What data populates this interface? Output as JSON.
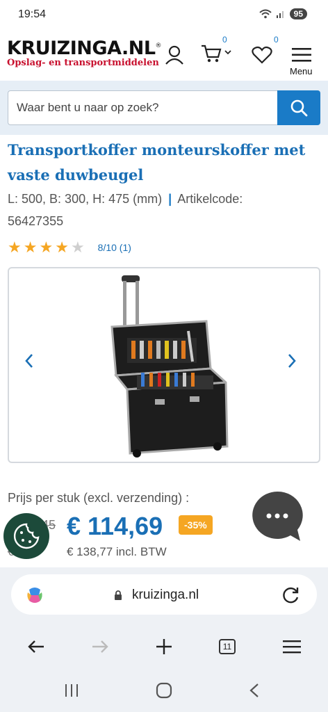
{
  "status_bar": {
    "time": "19:54",
    "battery": "95"
  },
  "header": {
    "logo": "KRUIZINGA.NL",
    "logo_reg": "®",
    "tagline": "Opslag- en transportmiddelen",
    "cart_count": "0",
    "wishlist_count": "0",
    "menu_label": "Menu"
  },
  "search": {
    "placeholder": "Waar bent u naar op zoek?"
  },
  "product": {
    "title": "Transportkoffer monteurskoffer met vaste duwbeugel",
    "dimensions": "L: 500, B: 300, H: 475 (mm)",
    "separator": "|",
    "article_code_label": "Artikelcode:",
    "article_code": "56427355",
    "rating_text": "8/10 (1)",
    "stars_filled": 4,
    "stars_total": 5
  },
  "price": {
    "label": "Prijs per stuk (excl. verzending) :",
    "old_price": "45",
    "price": "€ 114,69",
    "discount": "-35%",
    "old_price_incl": "€ 2,50",
    "price_incl": "€ 138,77 incl. BTW"
  },
  "browser": {
    "url": "kruizinga.nl",
    "tab_count": "11"
  },
  "colors": {
    "brand_blue": "#1a7bc7",
    "brand_red": "#c8102e",
    "discount_orange": "#f5a623"
  }
}
